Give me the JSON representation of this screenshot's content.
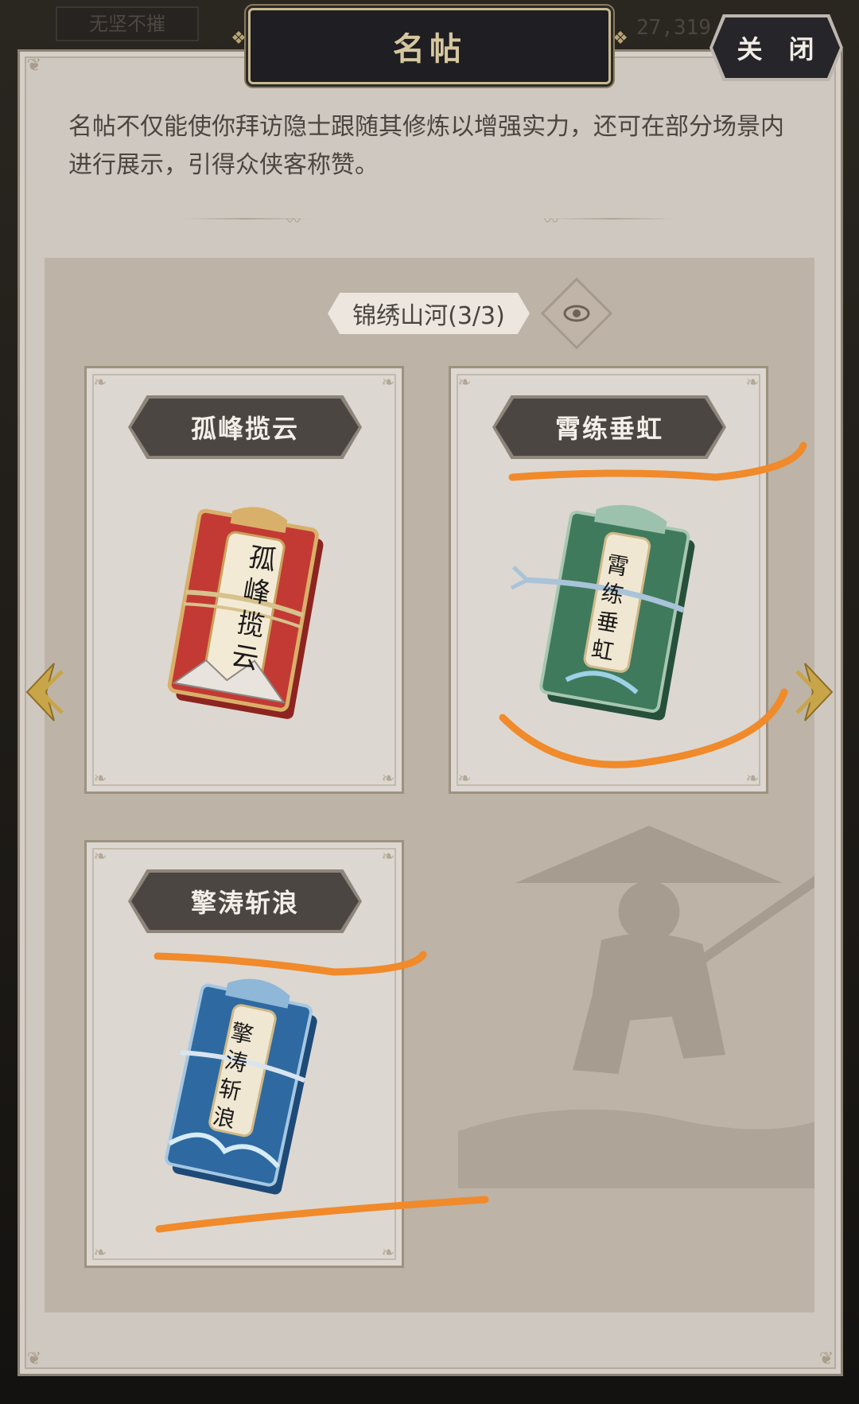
{
  "background": {
    "nickname": "无坚不摧",
    "count": "27,319"
  },
  "header": {
    "title": "名帖",
    "close_label": "关 闭"
  },
  "description": "名帖不仅能使你拜访隐士跟随其修炼以增强实力，还可在部分场景内进行展示，引得众侠客称赞。",
  "set": {
    "label": "锦绣山河(3/3)",
    "view_icon": "eye-icon"
  },
  "cards": [
    {
      "name": "孤峰揽云",
      "art_text": [
        "孤",
        "峰",
        "揽",
        "云"
      ],
      "color": "#c23a33"
    },
    {
      "name": "霄练垂虹",
      "art_text": [
        "霄",
        "练",
        "垂",
        "虹"
      ],
      "color": "#3f7a5d"
    },
    {
      "name": "擎涛斩浪",
      "art_text": [
        "擎",
        "涛",
        "斩",
        "浪"
      ],
      "color": "#2e6aa1"
    }
  ],
  "nav": {
    "prev_icon": "chevron-left-icon",
    "next_icon": "chevron-right-icon"
  },
  "colors": {
    "panel": "#cfc8c1",
    "accent_gold": "#c9b98f",
    "annotation": "#f08a2a"
  }
}
